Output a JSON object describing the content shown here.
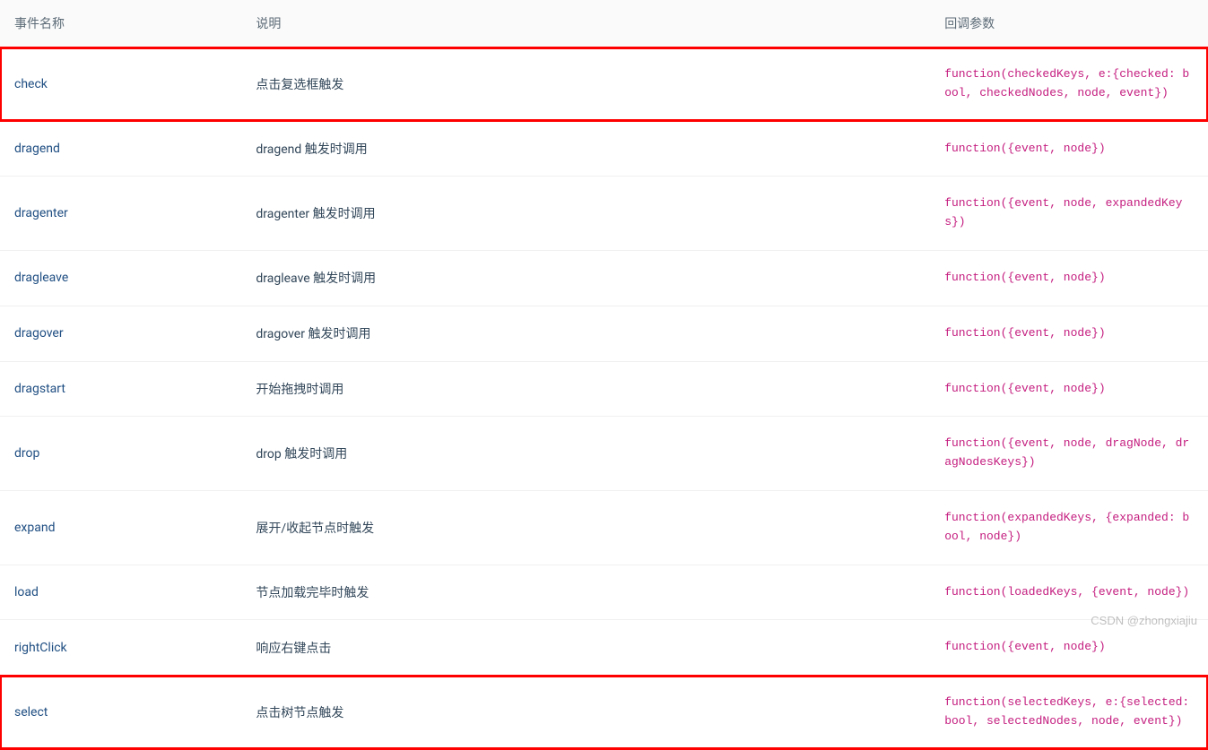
{
  "headers": {
    "name": "事件名称",
    "desc": "说明",
    "callback": "回调参数"
  },
  "rows": [
    {
      "name": "check",
      "desc": "点击复选框触发",
      "cb": "function(checkedKeys, e:{checked: bool, checkedNodes, node, event})",
      "hl": true
    },
    {
      "name": "dragend",
      "desc": "dragend 触发时调用",
      "cb": "function({event, node})",
      "hl": false
    },
    {
      "name": "dragenter",
      "desc": "dragenter 触发时调用",
      "cb": "function({event, node, expandedKeys})",
      "hl": false
    },
    {
      "name": "dragleave",
      "desc": "dragleave 触发时调用",
      "cb": "function({event, node})",
      "hl": false
    },
    {
      "name": "dragover",
      "desc": "dragover 触发时调用",
      "cb": "function({event, node})",
      "hl": false
    },
    {
      "name": "dragstart",
      "desc": "开始拖拽时调用",
      "cb": "function({event, node})",
      "hl": false
    },
    {
      "name": "drop",
      "desc": "drop 触发时调用",
      "cb": "function({event, node, dragNode, dragNodesKeys})",
      "hl": false
    },
    {
      "name": "expand",
      "desc": "展开/收起节点时触发",
      "cb": "function(expandedKeys, {expanded: bool, node})",
      "hl": false
    },
    {
      "name": "load",
      "desc": "节点加载完毕时触发",
      "cb": "function(loadedKeys, {event, node})",
      "hl": false
    },
    {
      "name": "rightClick",
      "desc": "响应右键点击",
      "cb": "function({event, node})",
      "hl": false
    },
    {
      "name": "select",
      "desc": "点击树节点触发",
      "cb": "function(selectedKeys, e:{selected: bool, selectedNodes, node, event})",
      "hl": true
    }
  ],
  "watermark": "CSDN @zhongxiajiu"
}
